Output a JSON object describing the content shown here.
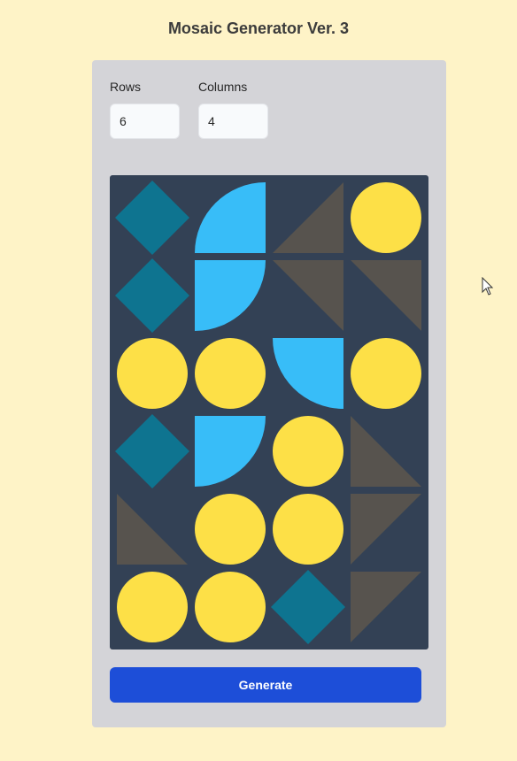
{
  "title": "Mosaic Generator Ver. 3",
  "controls": {
    "rows_label": "Rows",
    "rows_value": "6",
    "columns_label": "Columns",
    "columns_value": "4"
  },
  "generate_label": "Generate",
  "colors": {
    "page_bg": "#fef3c7",
    "panel_bg": "#d4d4d8",
    "canvas_bg": "#334155",
    "button_bg": "#1d4ed8",
    "diamond": "#0e7490",
    "quarter": "#38bdf8",
    "triangle": "#57534e",
    "circle": "#fde047"
  },
  "mosaic": {
    "rows": 6,
    "columns": 4,
    "tiles": [
      [
        "diamond",
        "quarter-bl",
        "triangle-br",
        "circle"
      ],
      [
        "diamond",
        "quarter-tl",
        "triangle-tr",
        "triangle-tr"
      ],
      [
        "circle",
        "circle",
        "quarter-tr",
        "circle"
      ],
      [
        "diamond",
        "quarter-tl",
        "circle",
        "triangle-bl"
      ],
      [
        "triangle-bl",
        "circle",
        "circle",
        "triangle-tl"
      ],
      [
        "circle",
        "circle",
        "diamond",
        "triangle-tl"
      ]
    ]
  }
}
